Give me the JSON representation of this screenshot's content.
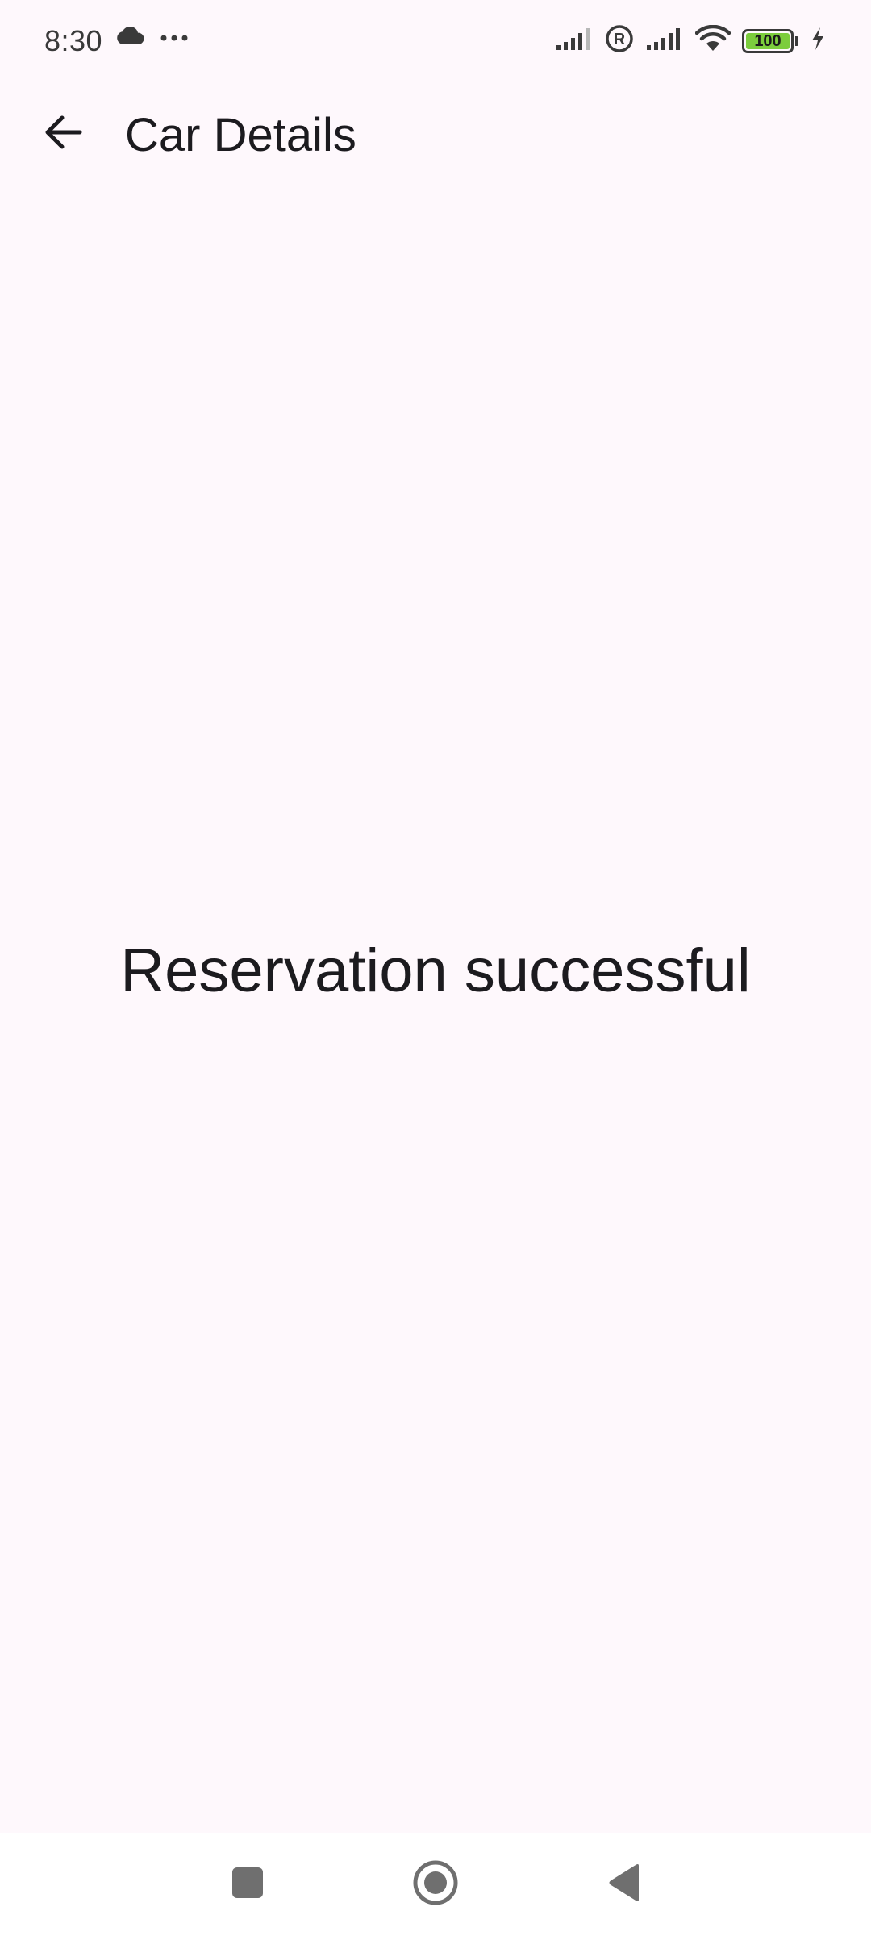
{
  "status_bar": {
    "time": "8:30",
    "left_icons": [
      "cloud-icon",
      "more-dots-icon"
    ],
    "right_icons": [
      "signal-icon",
      "registered-icon",
      "signal-icon",
      "wifi-icon",
      "battery-icon",
      "charging-icon"
    ],
    "battery_level": "100",
    "battery_color": "#7ccd3d"
  },
  "app_bar": {
    "back_icon": "arrow-back-icon",
    "title": "Car Details"
  },
  "main": {
    "message": "Reservation successful"
  },
  "nav_bar": {
    "buttons": [
      "recents-square-icon",
      "home-circle-icon",
      "back-triangle-icon"
    ]
  },
  "colors": {
    "background": "#fef8fc",
    "text": "#1c1b1f",
    "icon_gray": "#6f6f6f"
  }
}
